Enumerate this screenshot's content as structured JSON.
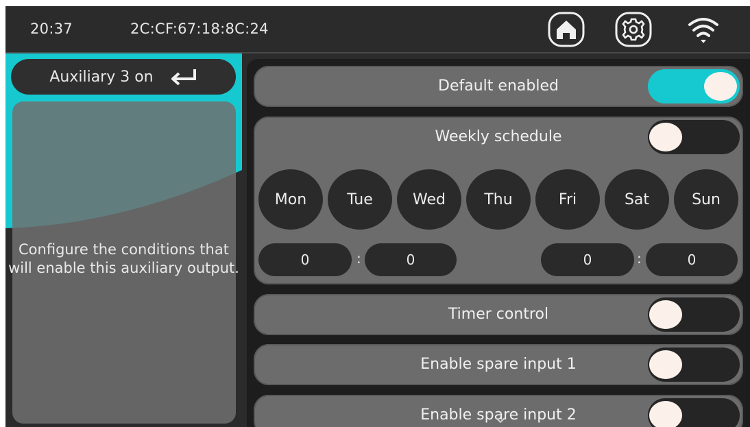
{
  "status": {
    "time": "20:37",
    "mac": "2C:CF:67:18:8C:24",
    "icons": [
      "home-icon",
      "gear-icon",
      "wifi-icon"
    ]
  },
  "panel": {
    "title": "Auxiliary 3 on",
    "back_icon": "return-arrow-icon",
    "description": "Configure the conditions that will enable this auxiliary output."
  },
  "settings": {
    "default_enabled": {
      "label": "Default enabled",
      "on": true
    },
    "weekly_schedule": {
      "label": "Weekly schedule",
      "on": false,
      "days": [
        "Mon",
        "Tue",
        "Wed",
        "Thu",
        "Fri",
        "Sat",
        "Sun"
      ],
      "start": {
        "hour": "0",
        "minute": "0"
      },
      "end": {
        "hour": "0",
        "minute": "0"
      },
      "separator": ":"
    },
    "timer_control": {
      "label": "Timer control",
      "on": false
    },
    "spare_input_1": {
      "label": "Enable spare input 1",
      "on": false
    },
    "spare_input_2": {
      "label": "Enable spare input 2",
      "on": false
    }
  },
  "colors": {
    "accent": "#16c9d0",
    "background": "#2b2b2b",
    "row": "#6c6c6c",
    "knob": "#fbf1ea"
  }
}
